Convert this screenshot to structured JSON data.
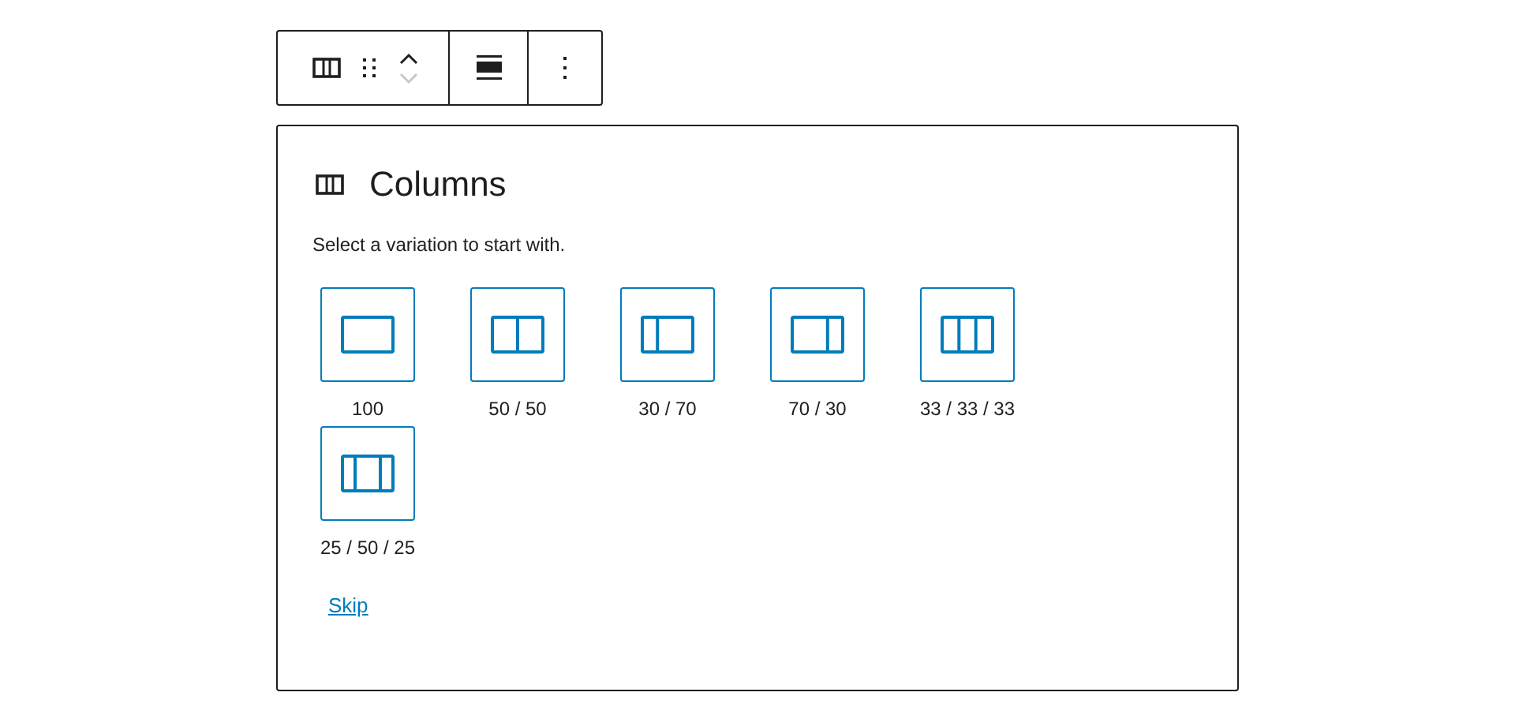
{
  "toolbar": {
    "move_up": {
      "disabled": false
    },
    "move_down": {
      "disabled": true
    }
  },
  "placeholder": {
    "title": "Columns",
    "instructions": "Select a variation to start with.",
    "variations": [
      {
        "label": "100",
        "kind": "full"
      },
      {
        "label": "50 / 50",
        "kind": "halves"
      },
      {
        "label": "30 / 70",
        "kind": "narrowleft"
      },
      {
        "label": "70 / 30",
        "kind": "narrowright"
      },
      {
        "label": "33 / 33 / 33",
        "kind": "thirds"
      },
      {
        "label": "25 / 50 / 25",
        "kind": "widecenter"
      }
    ],
    "skip": "Skip"
  }
}
